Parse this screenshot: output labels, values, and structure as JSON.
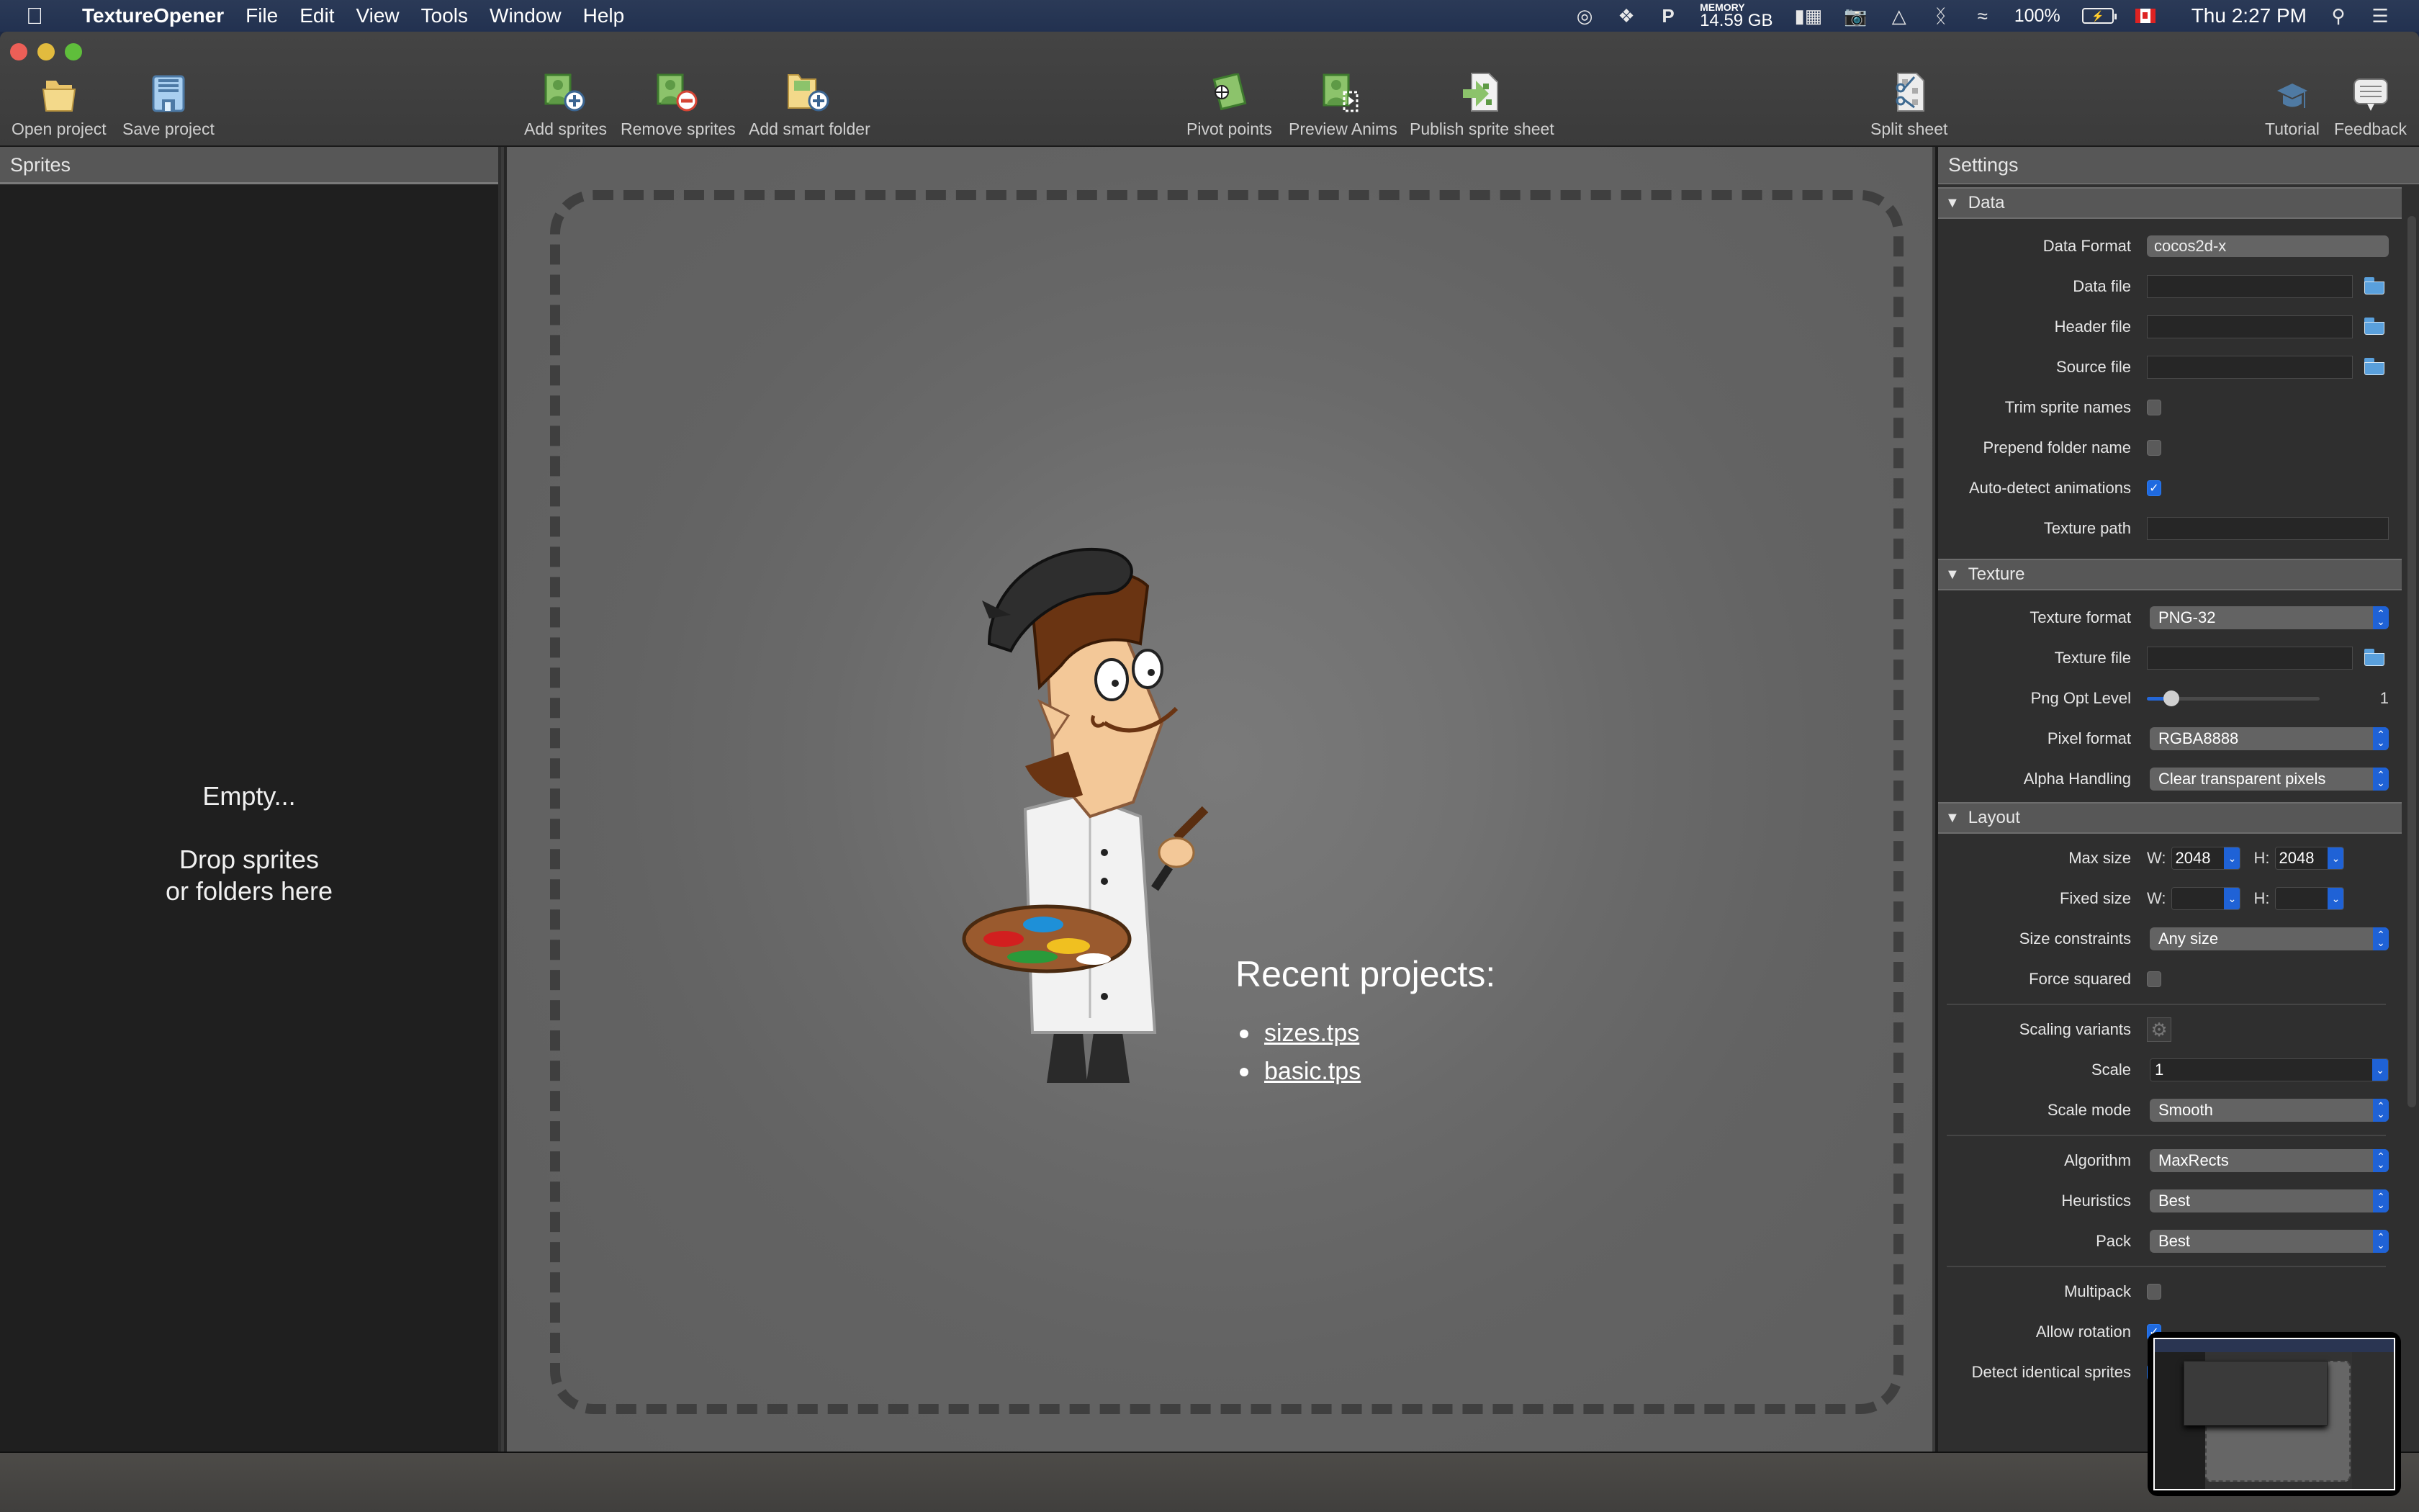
{
  "menubar": {
    "app_name": "TextureOpener",
    "menus": [
      "File",
      "Edit",
      "View",
      "Tools",
      "Window",
      "Help"
    ],
    "status": {
      "memory_label": "MEMORY",
      "memory_value": "14.59 GB",
      "battery_percent": "100%",
      "clock": "Thu 2:27 PM"
    }
  },
  "toolbar": {
    "open_project": "Open project",
    "save_project": "Save project",
    "add_sprites": "Add sprites",
    "remove_sprites": "Remove sprites",
    "add_smart_folder": "Add smart folder",
    "pivot_points": "Pivot points",
    "preview_anims": "Preview Anims",
    "publish_sprite_sheet": "Publish sprite sheet",
    "split_sheet": "Split sheet",
    "tutorial": "Tutorial",
    "feedback": "Feedback"
  },
  "sprites_panel": {
    "title": "Sprites",
    "empty_line1": "Empty...",
    "empty_line2": "Drop sprites",
    "empty_line3": "or folders here"
  },
  "canvas": {
    "recent_title": "Recent projects:",
    "recent_projects": [
      "sizes.tps",
      "basic.tps"
    ]
  },
  "settings": {
    "title": "Settings",
    "data": {
      "section": "Data",
      "data_format_label": "Data Format",
      "data_format_value": "cocos2d-x",
      "data_file_label": "Data file",
      "data_file_value": "",
      "header_file_label": "Header file",
      "header_file_value": "",
      "source_file_label": "Source file",
      "source_file_value": "",
      "trim_sprite_names_label": "Trim sprite names",
      "trim_sprite_names": false,
      "prepend_folder_name_label": "Prepend folder name",
      "prepend_folder_name": false,
      "auto_detect_animations_label": "Auto-detect animations",
      "auto_detect_animations": true,
      "texture_path_label": "Texture path",
      "texture_path_value": ""
    },
    "texture": {
      "section": "Texture",
      "texture_format_label": "Texture format",
      "texture_format_value": "PNG-32",
      "texture_file_label": "Texture file",
      "texture_file_value": "",
      "png_opt_level_label": "Png Opt Level",
      "png_opt_level_value": "1",
      "png_opt_level_fraction": 0.14,
      "pixel_format_label": "Pixel format",
      "pixel_format_value": "RGBA8888",
      "alpha_handling_label": "Alpha Handling",
      "alpha_handling_value": "Clear transparent pixels"
    },
    "layout": {
      "section": "Layout",
      "max_size_label": "Max size",
      "w_label": "W:",
      "h_label": "H:",
      "max_w": "2048",
      "max_h": "2048",
      "fixed_size_label": "Fixed size",
      "fixed_w": "",
      "fixed_h": "",
      "size_constraints_label": "Size constraints",
      "size_constraints_value": "Any size",
      "force_squared_label": "Force squared",
      "force_squared": false,
      "scaling_variants_label": "Scaling variants",
      "scale_label": "Scale",
      "scale_value": "1",
      "scale_mode_label": "Scale mode",
      "scale_mode_value": "Smooth",
      "algorithm_label": "Algorithm",
      "algorithm_value": "MaxRects",
      "heuristics_label": "Heuristics",
      "heuristics_value": "Best",
      "pack_label": "Pack",
      "pack_value": "Best",
      "multipack_label": "Multipack",
      "allow_rotation_label": "Allow rotation",
      "detect_identical_label": "Detect identical sprites"
    }
  }
}
